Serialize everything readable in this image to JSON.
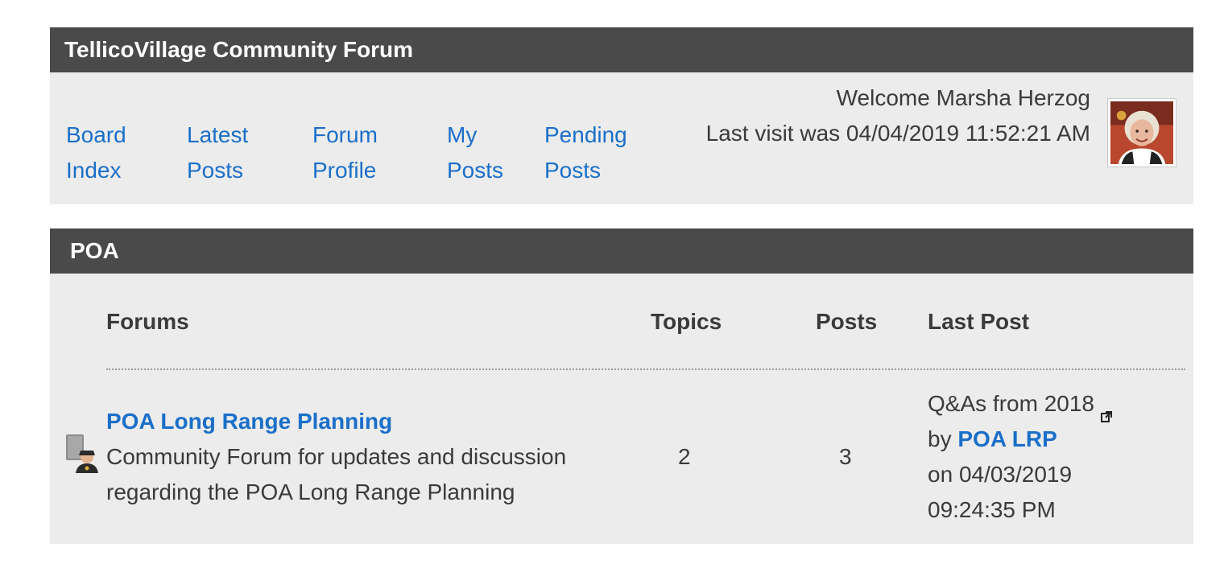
{
  "header": {
    "title": "TellicoVillage Community Forum"
  },
  "nav": {
    "items": [
      {
        "label": "Board\nIndex"
      },
      {
        "label": "Latest\nPosts"
      },
      {
        "label": "Forum\nProfile"
      },
      {
        "label": "My\nPosts"
      },
      {
        "label": "Pending\nPosts"
      }
    ]
  },
  "welcome": {
    "greeting": "Welcome Marsha Herzog",
    "last_visit": "Last visit was 04/04/2019 11:52:21 AM"
  },
  "category": {
    "title": "POA",
    "columns": {
      "forums": "Forums",
      "topics": "Topics",
      "posts": "Posts",
      "last_post": "Last Post"
    },
    "forums": [
      {
        "name": "POA Long Range Planning",
        "description": "Community Forum for updates and discussion regarding the POA Long Range Planning",
        "topics": "2",
        "posts": "3",
        "last_post": {
          "topic": "Q&As from 2018",
          "by_label": "by",
          "user": "POA LRP",
          "on_label": "on",
          "date": "04/03/2019",
          "time": "09:24:35 PM"
        }
      }
    ]
  },
  "colors": {
    "header_bg": "#4a4a4a",
    "panel_bg": "#ececec",
    "link": "#1a6fc9"
  },
  "icons": {
    "avatar": "user-avatar-photo",
    "forum": "forum-moderator-icon",
    "external": "external-link-icon"
  }
}
